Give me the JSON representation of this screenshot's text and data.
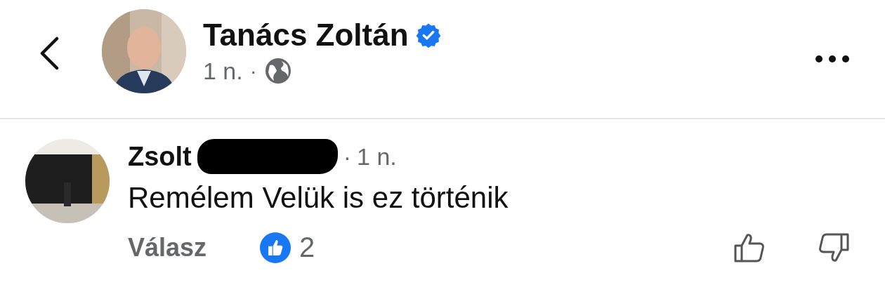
{
  "post_header": {
    "author": "Tanács Zoltán",
    "verified": true,
    "time": "1 n.",
    "separator": "·"
  },
  "comment": {
    "author": "Zsolt",
    "redacted": true,
    "separator": "·",
    "time": "1 n.",
    "text": "Remélem Velük is ez történik",
    "reply_label": "Válasz",
    "reaction_count": "2"
  }
}
